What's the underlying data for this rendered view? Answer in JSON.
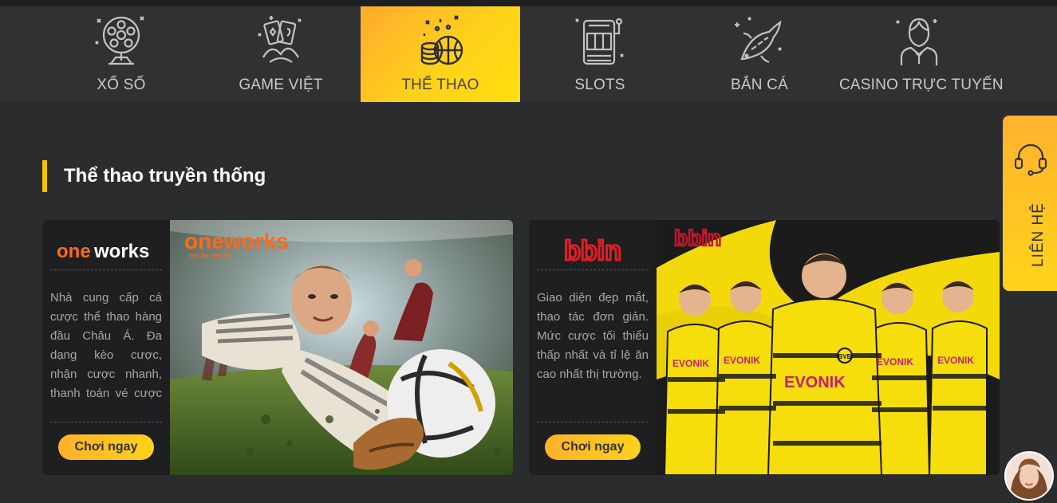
{
  "nav": {
    "items": [
      {
        "label": "XỔ SỐ",
        "icon": "lottery-ball-cage-icon"
      },
      {
        "label": "GAME VIỆT",
        "icon": "card-cards-icon"
      },
      {
        "label": "THỂ THAO",
        "icon": "basketball-coins-icon"
      },
      {
        "label": "SLOTS",
        "icon": "slot-machine-icon"
      },
      {
        "label": "BẮN CÁ",
        "icon": "koi-fish-icon"
      },
      {
        "label": "CASINO TRỰC TUYẾN",
        "icon": "casino-dealer-icon"
      }
    ],
    "active_index": 2,
    "active_color": "#ffd21a"
  },
  "section": {
    "title": "Thể thao truyền thống"
  },
  "cards": [
    {
      "logo_text": "oneworks",
      "banner_logo_text": "oneworks",
      "banner_tagline": "hot for minds",
      "description": "Nhà cung cấp cá cược thể thao hàng đầu Châu Á. Đa dạng kèo cược, nhận cược nhanh, thanh toán vé cược nhanh nhất.",
      "button": "Chơi ngay"
    },
    {
      "logo_text": "bbin",
      "banner_logo_text": "bbin",
      "description": "Giao diện đẹp mắt, thao tác đơn giản. Mức cược tối thiểu thấp nhất và tỉ lệ ăn cao nhất thị trường.",
      "button": "Chơi ngay",
      "jersey_text": "EVONIK"
    }
  ],
  "contact": {
    "label": "LIÊN HỆ"
  },
  "colors": {
    "accent": "#ffd21a",
    "background": "#2b2c2e",
    "card": "#1e1f21"
  }
}
